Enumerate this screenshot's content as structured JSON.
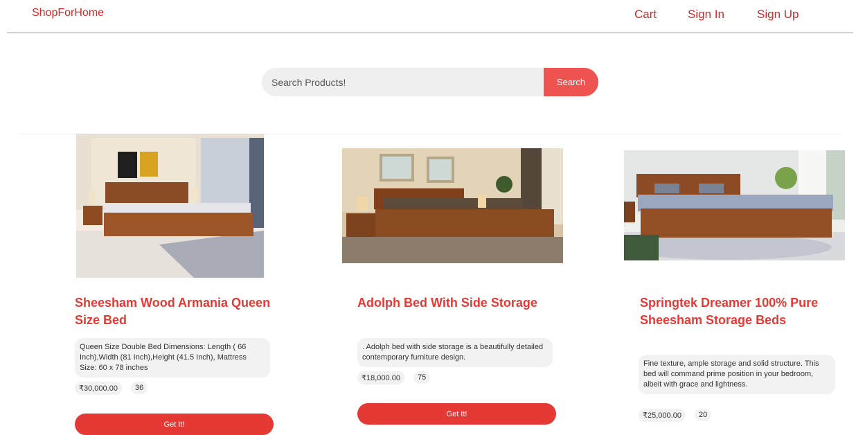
{
  "navbar": {
    "brand": "ShopForHome",
    "links": [
      "Cart",
      "Sign In",
      "Sign Up"
    ]
  },
  "search": {
    "placeholder": "Search Products!",
    "button_label": "Search"
  },
  "products": [
    {
      "title": "Sheesham Wood Armania Queen Size Bed",
      "description": "Queen Size Double Bed Dimensions: Length ( 66 Inch),Width (81 Inch),Height (41.5 Inch), Mattress Size: 60 x 78 inches",
      "price": "₹30,000.00",
      "stock": "36",
      "button_label": "Get It!"
    },
    {
      "title": "Adolph Bed With Side Storage",
      "description": ". Adolph bed with side storage is a beautifully detailed contemporary furniture design.",
      "price": "₹18,000.00",
      "stock": "75",
      "button_label": "Get It!"
    },
    {
      "title": "Springtek Dreamer 100% Pure Sheesham Storage Beds",
      "description": "Fine texture, ample storage and solid structure. This bed will command prime position in your bedroom, albeit with grace and lightness.",
      "price": "₹25,000.00",
      "stock": "20",
      "button_label": "Get It!"
    }
  ],
  "colors": {
    "accent": "#e53935",
    "search_button": "#ef5350",
    "pill_bg": "#f2f2f2"
  }
}
